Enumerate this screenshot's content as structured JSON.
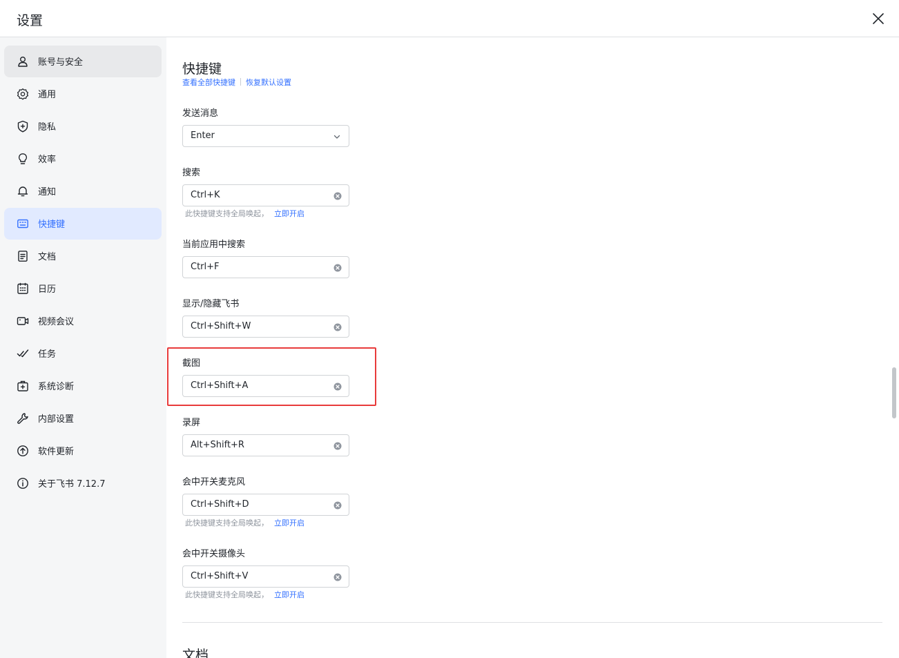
{
  "window": {
    "title": "设置"
  },
  "sidebar": {
    "items": [
      {
        "label": "账号与安全",
        "icon": "user-icon"
      },
      {
        "label": "通用",
        "icon": "gear-icon"
      },
      {
        "label": "隐私",
        "icon": "shield-icon"
      },
      {
        "label": "效率",
        "icon": "bulb-icon"
      },
      {
        "label": "通知",
        "icon": "bell-icon"
      },
      {
        "label": "快捷键",
        "icon": "keyboard-icon"
      },
      {
        "label": "文档",
        "icon": "document-icon"
      },
      {
        "label": "日历",
        "icon": "calendar-icon"
      },
      {
        "label": "视频会议",
        "icon": "video-icon"
      },
      {
        "label": "任务",
        "icon": "task-check-icon"
      },
      {
        "label": "系统诊断",
        "icon": "diagnose-icon"
      },
      {
        "label": "内部设置",
        "icon": "wrench-icon"
      },
      {
        "label": "软件更新",
        "icon": "upload-circle-icon"
      },
      {
        "label": "关于飞书 7.12.7",
        "icon": "info-icon"
      }
    ],
    "active_item": "快捷键",
    "hover_item": "账号与安全"
  },
  "main": {
    "section_title": "快捷键",
    "link_view_all": "查看全部快捷键",
    "link_restore": "恢复默认设置",
    "fields": [
      {
        "label": "发送消息",
        "value": "Enter",
        "type": "select"
      },
      {
        "label": "搜索",
        "value": "Ctrl+K",
        "hint": "此快捷键支持全局唤起，",
        "hint_link": "立即开启"
      },
      {
        "label": "当前应用中搜索",
        "value": "Ctrl+F"
      },
      {
        "label": "显示/隐藏飞书",
        "value": "Ctrl+Shift+W"
      },
      {
        "label": "截图",
        "value": "Ctrl+Shift+A",
        "highlighted": true
      },
      {
        "label": "录屏",
        "value": "Alt+Shift+R"
      },
      {
        "label": "会中开关麦克风",
        "value": "Ctrl+Shift+D",
        "hint": "此快捷键支持全局唤起，",
        "hint_link": "立即开启"
      },
      {
        "label": "会中开关摄像头",
        "value": "Ctrl+Shift+V",
        "hint": "此快捷键支持全局唤起，",
        "hint_link": "立即开启"
      }
    ],
    "next_section_title": "文档"
  },
  "colors": {
    "accent": "#3370ff",
    "active_bg": "#e1eaff",
    "highlight_border": "#e83a3a",
    "sidebar_bg": "#f5f6f7"
  }
}
